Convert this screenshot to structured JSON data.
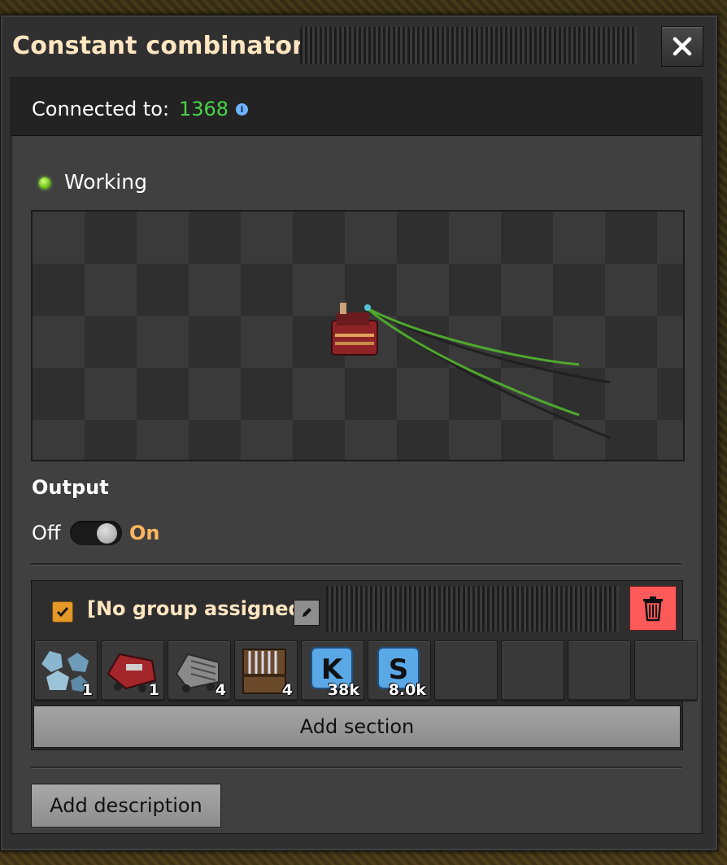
{
  "window": {
    "title": "Constant combinator",
    "close_icon": "close-icon"
  },
  "connection": {
    "label": "Connected to:",
    "value": "1368",
    "info_icon": "info-icon"
  },
  "status": {
    "text": "Working",
    "indicator_color": "#6fc11a"
  },
  "output": {
    "heading": "Output",
    "off_label": "Off",
    "on_label": "On",
    "state": "on"
  },
  "section": {
    "checked": true,
    "group_name": "[No group assigned]",
    "signals": [
      {
        "icon": "stone-ore-icon",
        "count": "1"
      },
      {
        "icon": "red-locomotive-icon",
        "count": "1"
      },
      {
        "icon": "cargo-wagon-icon",
        "count": "4"
      },
      {
        "icon": "wooden-chest-icon",
        "count": "4"
      },
      {
        "icon": "signal-k-icon",
        "letter": "K",
        "count": "38k"
      },
      {
        "icon": "signal-s-icon",
        "letter": "S",
        "count": "8.0k"
      },
      {
        "icon": "",
        "count": ""
      },
      {
        "icon": "",
        "count": ""
      },
      {
        "icon": "",
        "count": ""
      },
      {
        "icon": "",
        "count": ""
      }
    ],
    "add_section_label": "Add section"
  },
  "add_description_label": "Add description",
  "colors": {
    "accent_orange": "#ffb65c",
    "connected_green": "#47d546",
    "delete_red": "#ff5a5a",
    "title_cream": "#ffe6c0"
  }
}
